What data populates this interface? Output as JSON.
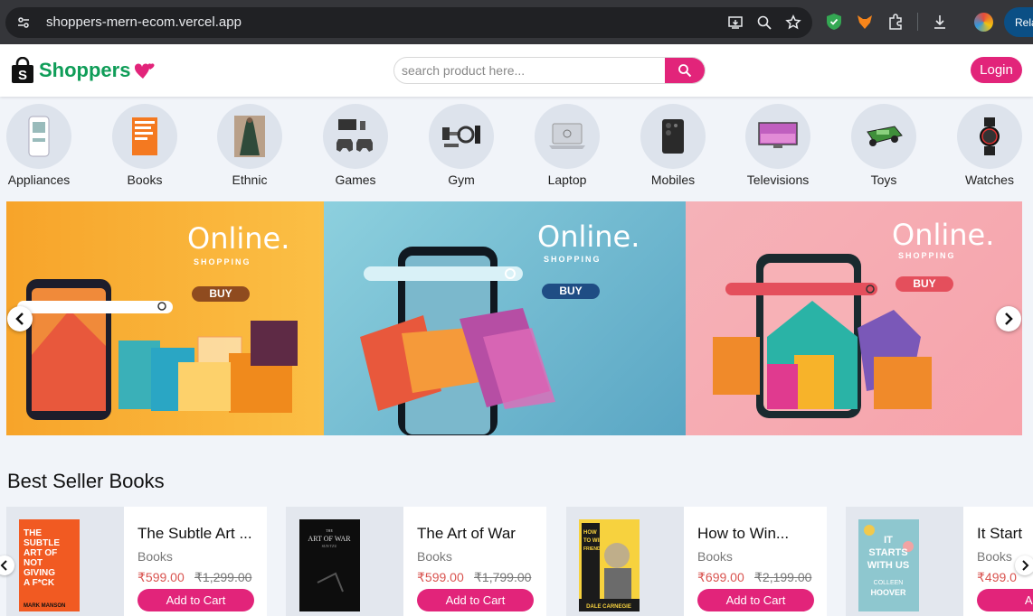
{
  "browser": {
    "url": "shoppers-mern-ecom.vercel.app",
    "relaunch_label": "Rela"
  },
  "header": {
    "logo_text": "Shoppers",
    "search_placeholder": "search product here...",
    "login_label": "Login",
    "accent_color": "#e2247a",
    "brand_color": "#0f9d58"
  },
  "categories": [
    {
      "label": "Appliances",
      "icon": "air-cooler"
    },
    {
      "label": "Books",
      "icon": "book"
    },
    {
      "label": "Ethnic",
      "icon": "dress"
    },
    {
      "label": "Games",
      "icon": "game-controller"
    },
    {
      "label": "Gym",
      "icon": "dumbbell"
    },
    {
      "label": "Laptop",
      "icon": "laptop"
    },
    {
      "label": "Mobiles",
      "icon": "phone"
    },
    {
      "label": "Televisions",
      "icon": "tv"
    },
    {
      "label": "Toys",
      "icon": "toy-car"
    },
    {
      "label": "Watches",
      "icon": "watch"
    }
  ],
  "banner": {
    "panels": [
      {
        "online": "Online.",
        "shopping": "SHOPPING",
        "buy": "BUY"
      },
      {
        "online": "Online.",
        "shopping": "SHOPPING",
        "buy": "BUY"
      },
      {
        "online": "Online.",
        "shopping": "SHOPPING",
        "buy": "BUY"
      }
    ]
  },
  "best_sellers": {
    "title": "Best Seller Books",
    "items": [
      {
        "title": "The Subtle Art ...",
        "category": "Books",
        "price": "₹599.00",
        "mrp": "₹1,299.00",
        "cta": "Add to Cart"
      },
      {
        "title": "The Art of War",
        "category": "Books",
        "price": "₹599.00",
        "mrp": "₹1,799.00",
        "cta": "Add to Cart"
      },
      {
        "title": "How to Win...",
        "category": "Books",
        "price": "₹699.00",
        "mrp": "₹2,199.00",
        "cta": "Add to Cart"
      },
      {
        "title": "It Start",
        "category": "Books",
        "price": "₹499.0",
        "mrp": "",
        "cta": "Add"
      }
    ]
  },
  "book_covers": [
    {
      "text": "THE SUBTLE ART OF NOT GIVING A F*CK",
      "author": "MARK MANSON"
    },
    {
      "text": "ART OF WAR",
      "author": "SUN TZU"
    },
    {
      "text": "HOW TO WIN FRIENDS AND INFLUENCE PEOPLE",
      "author": "DALE CARNEGIE"
    },
    {
      "text": "IT STARTS WITH US",
      "author": "COLLEEN HOOVER"
    }
  ]
}
